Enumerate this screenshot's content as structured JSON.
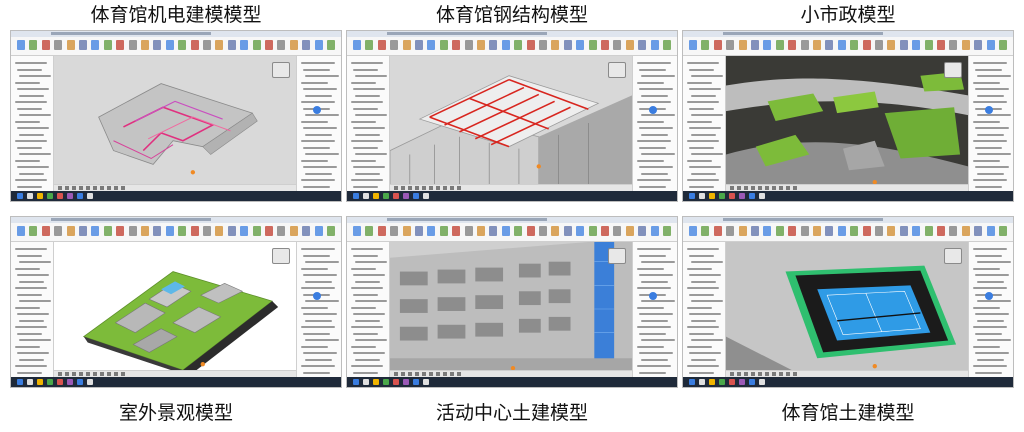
{
  "panels": [
    {
      "caption": "体育馆机电建模模型",
      "scene": "mep"
    },
    {
      "caption": "体育馆钢结构模型",
      "scene": "steel"
    },
    {
      "caption": "小市政模型",
      "scene": "municipal"
    },
    {
      "caption": "室外景观模型",
      "scene": "landscape"
    },
    {
      "caption": "活动中心土建模型",
      "scene": "activity"
    },
    {
      "caption": "体育馆土建模型",
      "scene": "gym"
    }
  ],
  "colors": {
    "pipe_magenta": "#e0307f",
    "steel_red": "#d8261f",
    "grass_green": "#7dbb3a",
    "court_blue": "#2f9be6",
    "selection_blue": "#3a7de0"
  }
}
